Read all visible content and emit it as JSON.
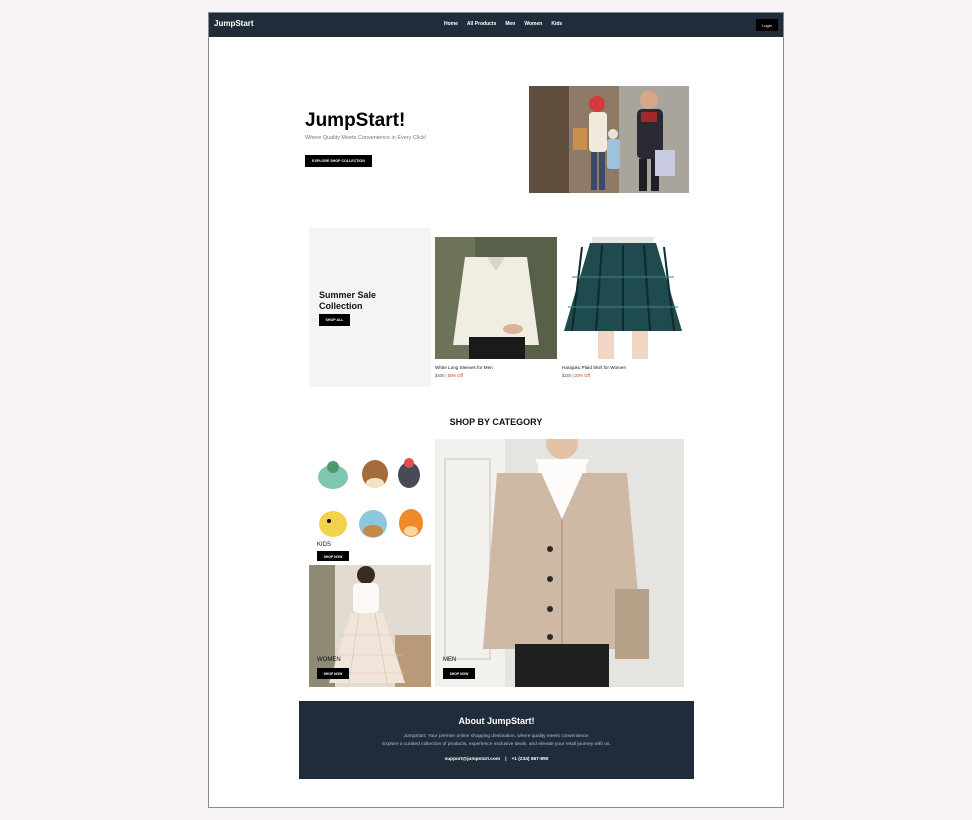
{
  "nav": {
    "brand": "JumpStart",
    "links": [
      "Home",
      "All Products",
      "Men",
      "Women",
      "Kids"
    ],
    "login": "Login"
  },
  "hero": {
    "title": "JumpStart!",
    "subtitle": "Where Quality Meets Convenience in Every Click!",
    "button": "EXPLORE SHOP COLLECTION"
  },
  "sale": {
    "title_line1": "Summer Sale",
    "title_line2": "Collection",
    "button": "SHOP ALL"
  },
  "products": [
    {
      "name": "White Long Sleeves for Men",
      "price": "$400",
      "discount": "50% Off"
    },
    {
      "name": "Harajuku Plaid Skirt for Women",
      "price": "$250",
      "discount": "20% Off"
    }
  ],
  "categories": {
    "title": "SHOP BY CATEGORY",
    "items": [
      {
        "label": "KIDS",
        "button": "SHOP NOW"
      },
      {
        "label": "WOMEN",
        "button": "SHOP NOW"
      },
      {
        "label": "MEN",
        "button": "SHOP NOW"
      }
    ]
  },
  "about": {
    "title": "About JumpStart!",
    "line1": "JumpStart: Your premier online shopping destination, where quality meets convenience.",
    "line2": "Explore a curated collection of products, experience exclusive deals, and elevate your retail journey with us.",
    "email": "support@jumpstart.com",
    "separator": "|",
    "phone": "+1 (234) 567-890"
  },
  "colors": {
    "nav_bg": "#212c3b",
    "accent": "#000000",
    "discount": "#c0392b"
  }
}
